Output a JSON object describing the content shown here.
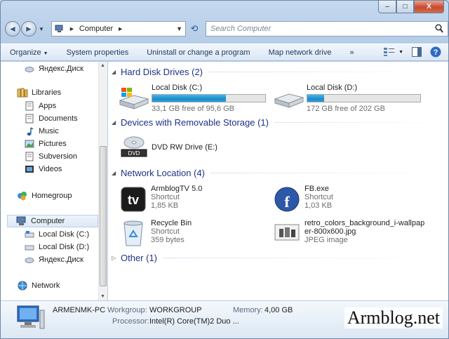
{
  "titlebar": {
    "minimize_glyph": "–",
    "maximize_glyph": "□",
    "close_glyph": "X"
  },
  "nav": {
    "back_glyph": "◄",
    "forward_glyph": "►",
    "history_glyph": "▼",
    "refresh_glyph": "⟲"
  },
  "address": {
    "crumb": "Computer",
    "chevron": "►",
    "dropdown": "▼"
  },
  "search": {
    "placeholder": "Search Computer"
  },
  "toolbar": {
    "organize": "Organize",
    "system_properties": "System properties",
    "uninstall": "Uninstall or change a program",
    "map_drive": "Map network drive",
    "more": "»"
  },
  "sidebar": {
    "yandex_top": "Яндекс.Диск",
    "libraries": "Libraries",
    "apps": "Apps",
    "documents": "Documents",
    "music": "Music",
    "pictures": "Pictures",
    "subversion": "Subversion",
    "videos": "Videos",
    "homegroup": "Homegroup",
    "computer": "Computer",
    "local_c": "Local Disk (C:)",
    "local_d": "Local Disk (D:)",
    "yandex": "Яндекс.Диск",
    "network": "Network"
  },
  "groups": {
    "hdd": "Hard Disk Drives (2)",
    "removable": "Devices with Removable Storage (1)",
    "network": "Network Location (4)",
    "other": "Other (1)"
  },
  "drives": [
    {
      "name": "Local Disk (C:)",
      "free": "33,1 GB free of 95,6 GB",
      "used_fraction": 0.654
    },
    {
      "name": "Local Disk (D:)",
      "free": "172 GB free of 202 GB",
      "used_fraction": 0.149
    }
  ],
  "dvd": {
    "name": "DVD RW Drive (E:)",
    "icon_label": "DVD"
  },
  "network_items": [
    {
      "name": "ArmblogTV 5.0",
      "type": "Shortcut",
      "size": "1,85 KB",
      "icon_text": "tv"
    },
    {
      "name": "FB.exe",
      "type": "Shortcut",
      "size": "1,03 KB",
      "icon_text": "f"
    },
    {
      "name": "Recycle Bin",
      "type": "Shortcut",
      "size": "359 bytes"
    },
    {
      "name_line1": "retro_colors_background_i-wallpap",
      "name_line2": "er-800x600.jpg",
      "type": "JPEG image"
    }
  ],
  "details": {
    "pc_name": "ARMENMK-PC",
    "workgroup_label": "Workgroup:",
    "workgroup": "WORKGROUP",
    "memory_label": "Memory:",
    "memory": "4,00 GB",
    "processor_label": "Processor:",
    "processor": "Intel(R) Core(TM)2 Duo ..."
  },
  "watermark": "Armblog.net",
  "colors": {
    "accent": "#1e3287",
    "bar_fill": "#26a0da",
    "toolbar_bg": "#dbe7f5",
    "close": "#c84a2d"
  }
}
